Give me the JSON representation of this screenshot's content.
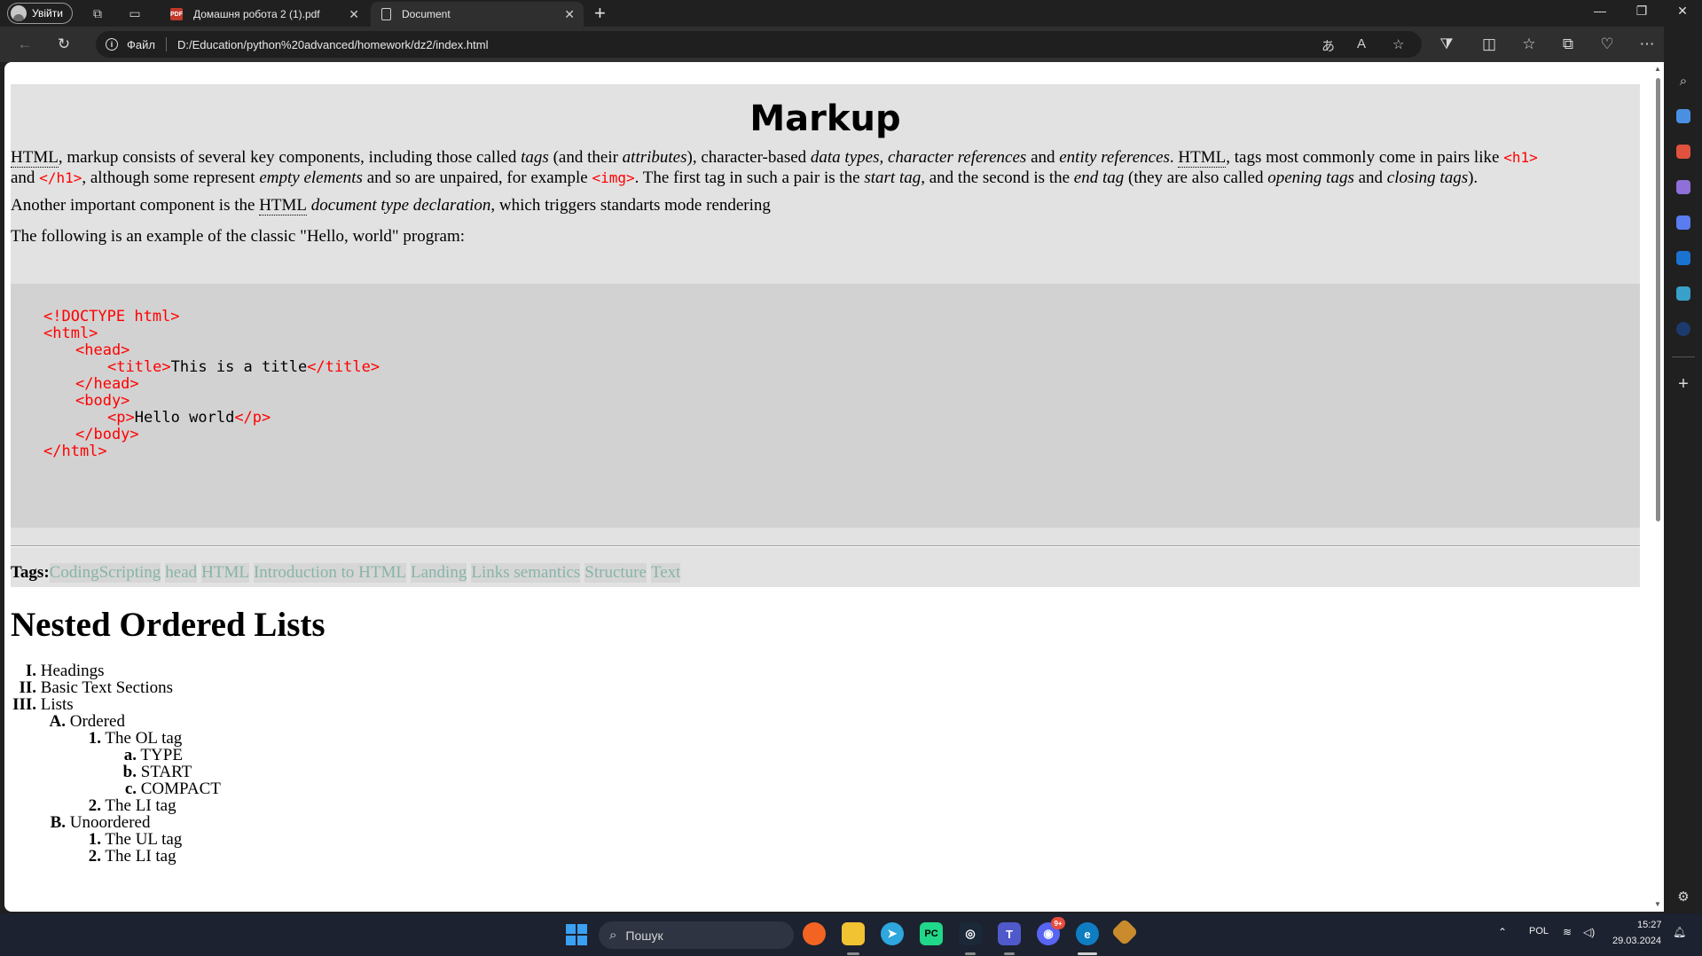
{
  "browser": {
    "profile_label": "Увійти",
    "tabs": [
      {
        "title": "Домашня робота 2 (1).pdf",
        "icon": "pdf-icon"
      },
      {
        "title": "Document",
        "icon": "document-icon"
      }
    ],
    "new_tab": "+",
    "address": {
      "label": "Файл",
      "url": "D:/Education/python%20advanced/homework/dz2/index.html"
    }
  },
  "page": {
    "markup_title": "Markup",
    "p1": {
      "a1": "HTML",
      "t1": ", markup consists of several key components, including those called ",
      "i1": "tags",
      "t2": " (and their ",
      "i2": "attributes",
      "t3": "), character-based ",
      "i3": "data types, character references",
      "t4": " and ",
      "i4": "entity references",
      "t5": ". ",
      "a2": "HTML",
      "t6": ", tags most commonly come in pairs like ",
      "c1": "<h1>",
      "t7": "and ",
      "c2": "</h1>",
      "t8": ", although some represent ",
      "i5": "empty elements",
      "t9": " and so are unpaired, for example ",
      "c3": "<img>",
      "t10": ". The first tag in such a pair is the ",
      "i6": "start tag,",
      "t11": " and the second is the ",
      "i7": "end tag",
      "t12": " (they are also called ",
      "i8": "opening tags",
      "t13": " and ",
      "i9": "closing tags",
      "t14": ")."
    },
    "p2": {
      "t1": "Another important component is the ",
      "a1": "HTML",
      "i1": " document type declaration",
      "t2": ", which triggers standarts mode rendering"
    },
    "p3": "The following is an example of the classic \"Hello, world\" program:",
    "code": {
      "l1": "<!DOCTYPE html>",
      "l2": "<html>",
      "l3": "<head>",
      "l4_open": "<title>",
      "l4_text": "This is a title",
      "l4_close": "</title>",
      "l5": "</head>",
      "l6": "<body>",
      "l7_open": "<p>",
      "l7_text": "Hello world",
      "l7_close": "</p>",
      "l8": "</body>",
      "l9": "</html>"
    },
    "tags_label": "Tags:",
    "tags": [
      "CodingScripting",
      "head",
      "HTML",
      "Introduction to HTML",
      "Landing",
      "Links semantics",
      "Structure",
      "Text"
    ],
    "nested_title": "Nested Ordered Lists",
    "list": [
      {
        "marker": "I.",
        "text": "Headings"
      },
      {
        "marker": "II.",
        "text": "Basic Text Sections"
      },
      {
        "marker": "III.",
        "text": "Lists"
      },
      {
        "marker": "A.",
        "text": "Ordered"
      },
      {
        "marker": "1.",
        "text": "The OL tag"
      },
      {
        "marker": "a.",
        "text": "TYPE"
      },
      {
        "marker": "b.",
        "text": "START"
      },
      {
        "marker": "c.",
        "text": "COMPACT"
      },
      {
        "marker": "2.",
        "text": "The LI tag"
      },
      {
        "marker": "B.",
        "text": "Unoordered"
      },
      {
        "marker": "1.",
        "text": "The UL tag"
      },
      {
        "marker": "2.",
        "text": "The LI tag"
      }
    ]
  },
  "taskbar": {
    "search_placeholder": "Пошук",
    "language": "POL",
    "time": "15:27",
    "date": "29.03.2024",
    "discord_badge": "9+"
  },
  "colors": {
    "code_tag": "#ff0000",
    "tag_chip_text": "#88b4a8",
    "section_bg": "#e2e2e2",
    "code_bg": "#d2d2d2"
  }
}
